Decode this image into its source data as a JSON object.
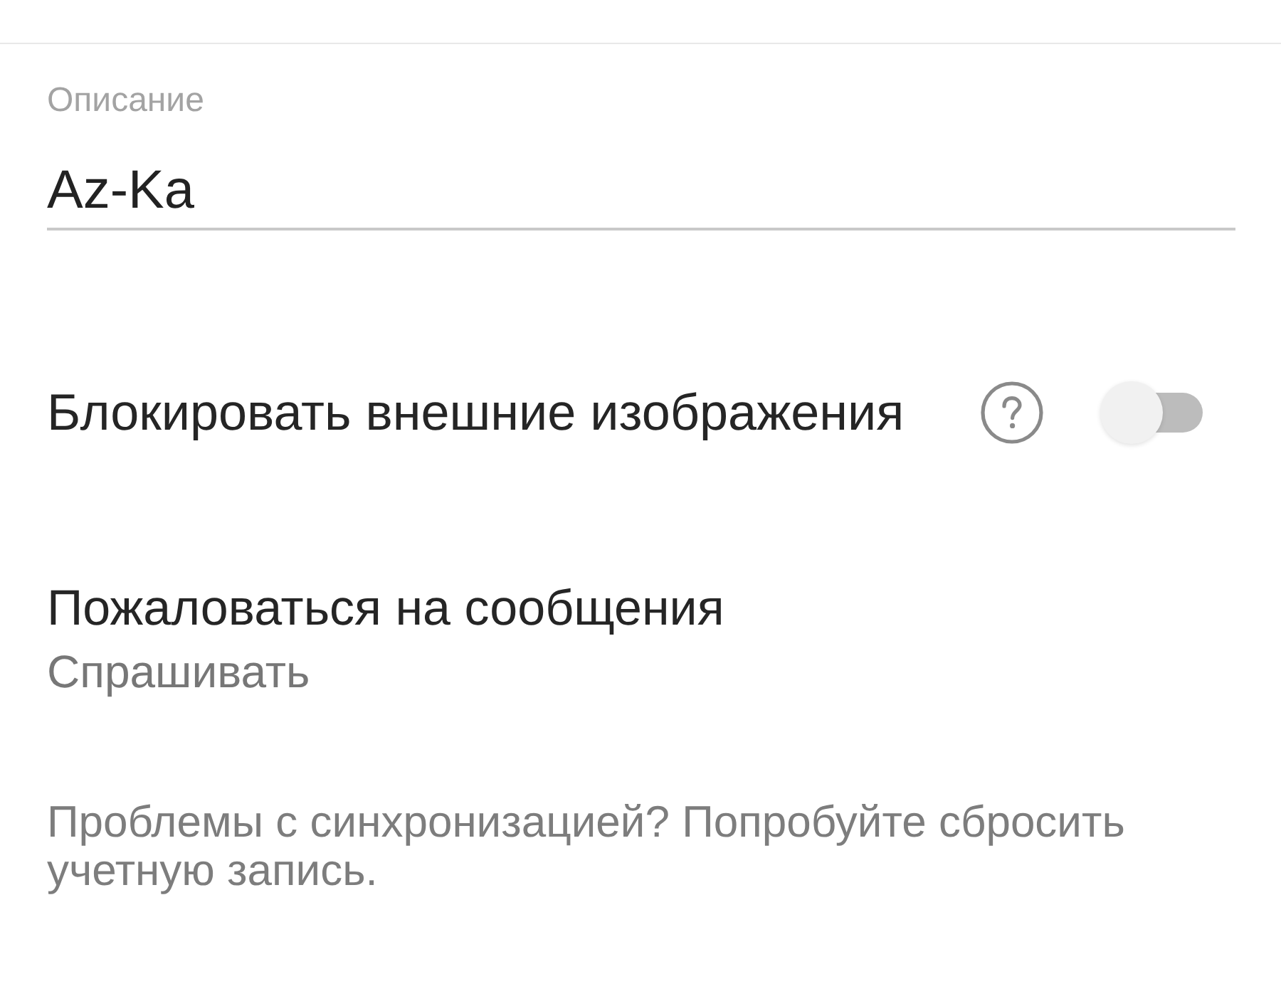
{
  "description_field": {
    "label": "Описание",
    "value": "Az-Ka"
  },
  "settings": [
    {
      "kind": "switch",
      "label": "Блокировать внешние изображения",
      "help": true,
      "on": false
    },
    {
      "kind": "choice",
      "label": "Пожаловаться на сообщения",
      "value": "Спрашивать"
    }
  ],
  "sync_hint": "Проблемы с синхронизацией? Попробуйте сбросить учетную запись."
}
